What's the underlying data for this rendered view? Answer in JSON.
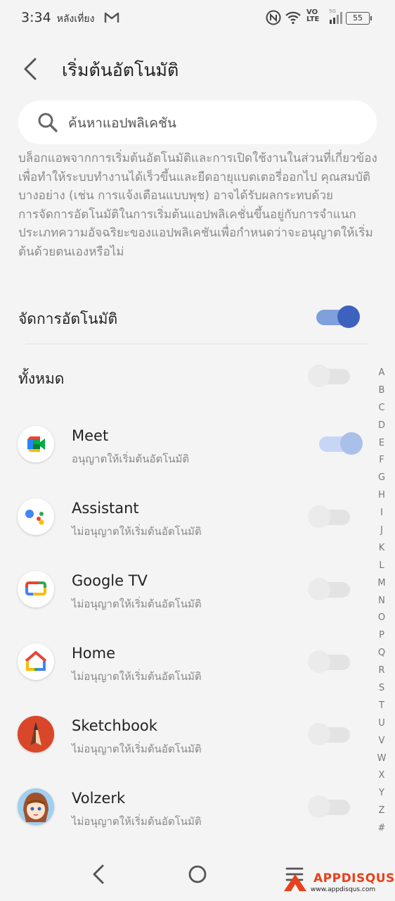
{
  "status_bar": {
    "time": "3:34",
    "ampm": "หลังเที่ยง",
    "network_label": "VO\nLTE",
    "signal_label": "5G",
    "battery": "55"
  },
  "header": {
    "title": "เริ่มต้นอัตโนมัติ"
  },
  "search": {
    "placeholder": "ค้นหาแอปพลิเคชัน"
  },
  "description": {
    "paragraph1": "บล็อกแอพจากการเริ่มต้นอัตโนมัติและการเปิดใช้งานในส่วนที่เกี่ยวข้องเพื่อทำให้ระบบทำงานได้เร็วขึ้นและยืดอายุแบตเตอรี่ออกไป คุณสมบัติบางอย่าง (เช่น การแจ้งเตือนแบบพุช) อาจได้รับผลกระทบด้วย",
    "paragraph2": "การจัดการอัตโนมัติในการเริ่มต้นแอปพลิเคชั่นขึ้นอยู่กับการจำแนกประเภทความอัจฉริยะของแอปพลิเคชันเพื่อกำหนดว่าจะอนุญาตให้เริ่มต้นด้วยตนเองหรือไม่"
  },
  "auto_manage": {
    "label": "จัดการอัตโนมัติ",
    "enabled": true
  },
  "all": {
    "label": "ทั้งหมด",
    "enabled": false
  },
  "apps": [
    {
      "name": "Meet",
      "status": "อนุญาตให้เริ่มต้นอัตโนมัติ",
      "enabled": true,
      "icon": "google-meet-icon"
    },
    {
      "name": "Assistant",
      "status": "ไม่อนุญาตให้เริ่มต้นอัตโนมัติ",
      "enabled": false,
      "icon": "google-assistant-icon"
    },
    {
      "name": "Google TV",
      "status": "ไม่อนุญาตให้เริ่มต้นอัตโนมัติ",
      "enabled": false,
      "icon": "google-tv-icon"
    },
    {
      "name": "Home",
      "status": "ไม่อนุญาตให้เริ่มต้นอัตโนมัติ",
      "enabled": false,
      "icon": "google-home-icon"
    },
    {
      "name": "Sketchbook",
      "status": "ไม่อนุญาตให้เริ่มต้นอัตโนมัติ",
      "enabled": false,
      "icon": "sketchbook-icon"
    },
    {
      "name": "Volzerk",
      "status": "ไม่อนุญาตให้เริ่มต้นอัตโนมัติ",
      "enabled": false,
      "icon": "volzerk-icon"
    }
  ],
  "alphabet_index": [
    "A",
    "B",
    "C",
    "D",
    "E",
    "F",
    "G",
    "H",
    "I",
    "J",
    "K",
    "L",
    "M",
    "N",
    "O",
    "P",
    "Q",
    "R",
    "S",
    "T",
    "U",
    "V",
    "W",
    "X",
    "Y",
    "Z",
    "#"
  ],
  "watermark": {
    "brand": "APPDISQUS",
    "url": "www.appdisqus.com"
  },
  "colors": {
    "accent": "#3d62be",
    "background": "#f4f4f4"
  }
}
